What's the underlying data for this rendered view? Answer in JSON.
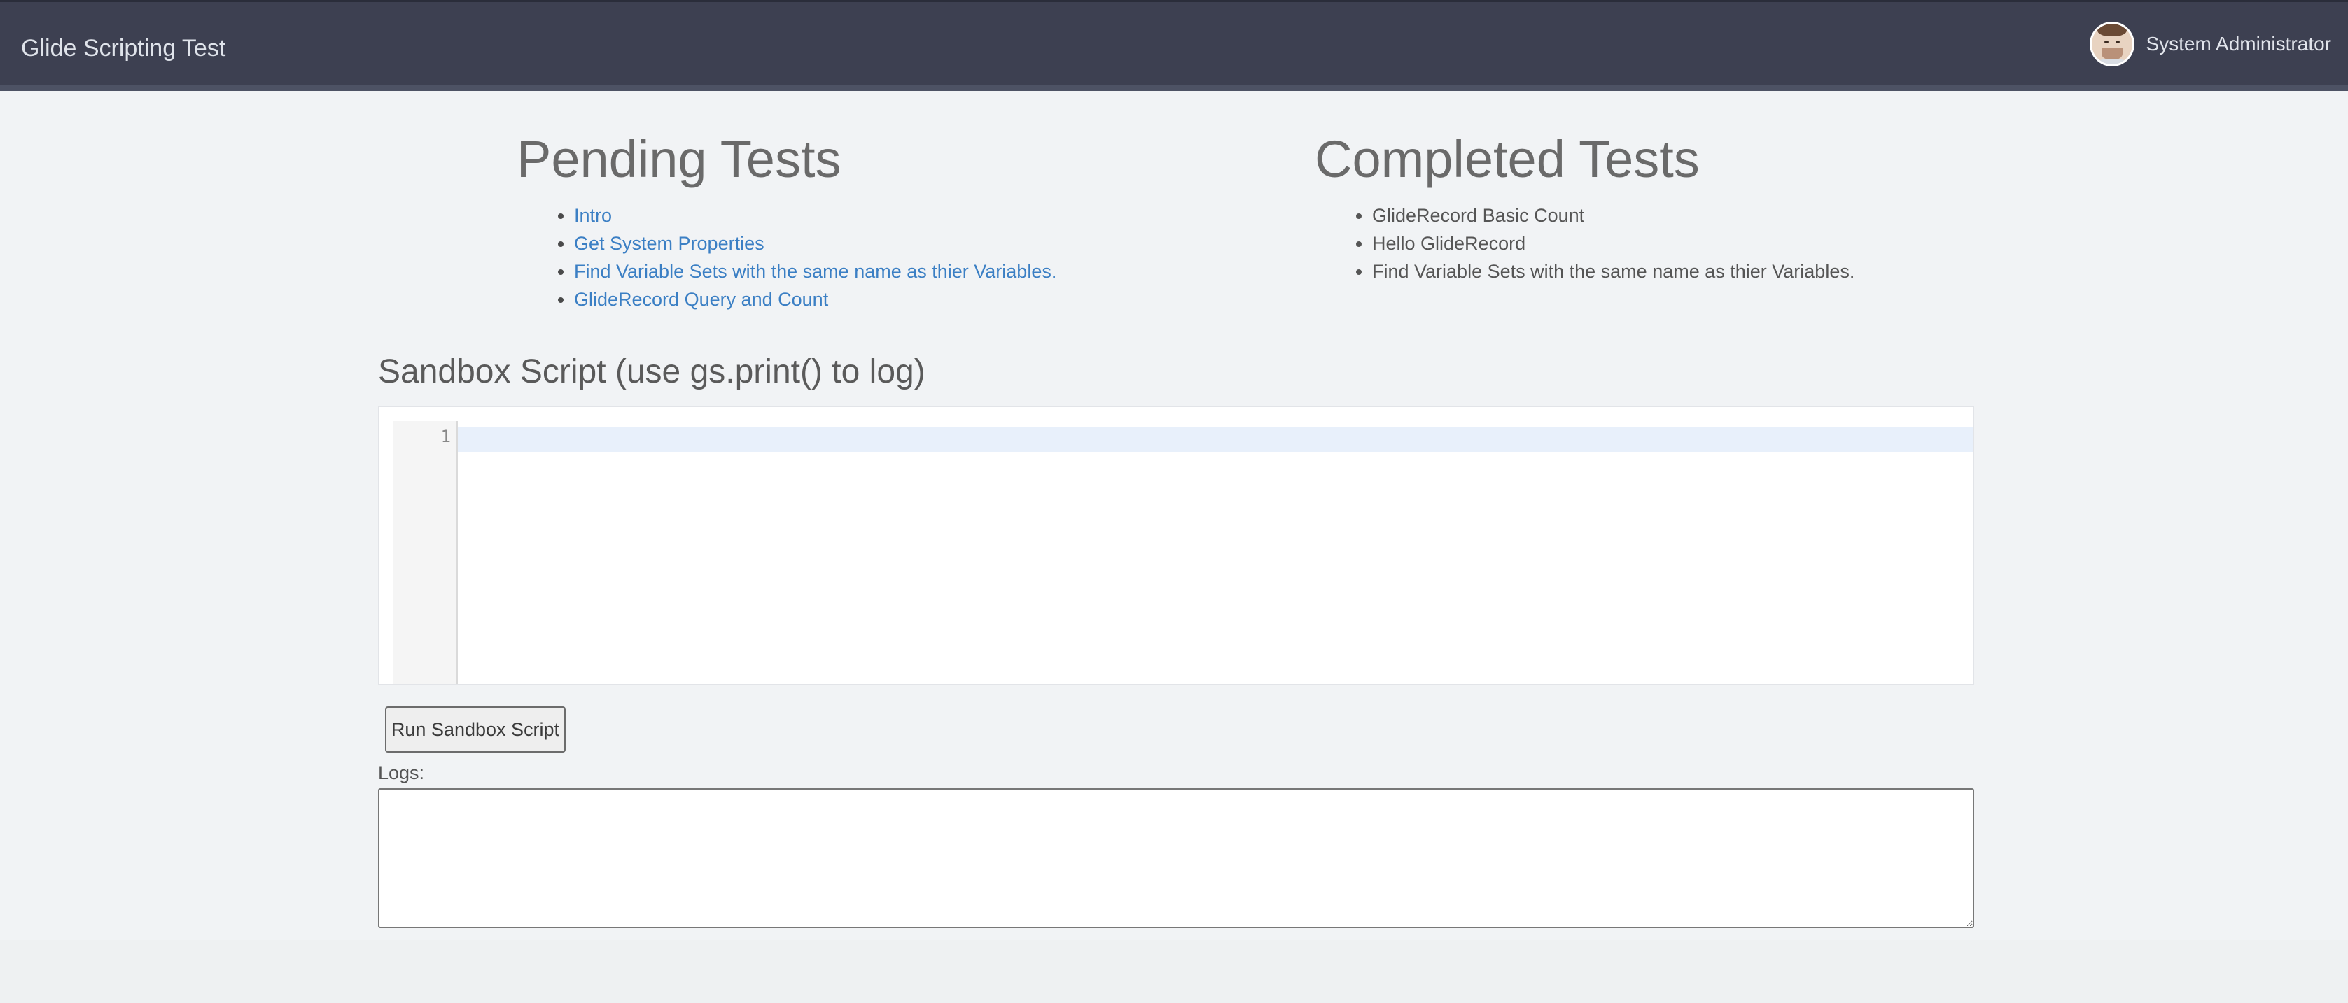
{
  "header": {
    "title": "Glide Scripting Test",
    "user_name": "System Administrator",
    "avatar_icon": "user-avatar"
  },
  "pending": {
    "heading": "Pending Tests",
    "items": [
      "Intro",
      "Get System Properties",
      "Find Variable Sets with the same name as thier Variables.",
      "GlideRecord Query and Count"
    ]
  },
  "completed": {
    "heading": "Completed Tests",
    "items": [
      "GlideRecord Basic Count",
      "Hello GlideRecord",
      "Find Variable Sets with the same name as thier Variables."
    ]
  },
  "sandbox": {
    "heading": "Sandbox Script (use gs.print() to log)",
    "line_number": "1",
    "code": "",
    "run_button_label": "Run Sandbox Script",
    "logs_label": "Logs:",
    "logs_value": ""
  },
  "colors": {
    "header_bg": "#3d4051",
    "link": "#3b7fc4",
    "page_bg": "#f1f3f5"
  }
}
